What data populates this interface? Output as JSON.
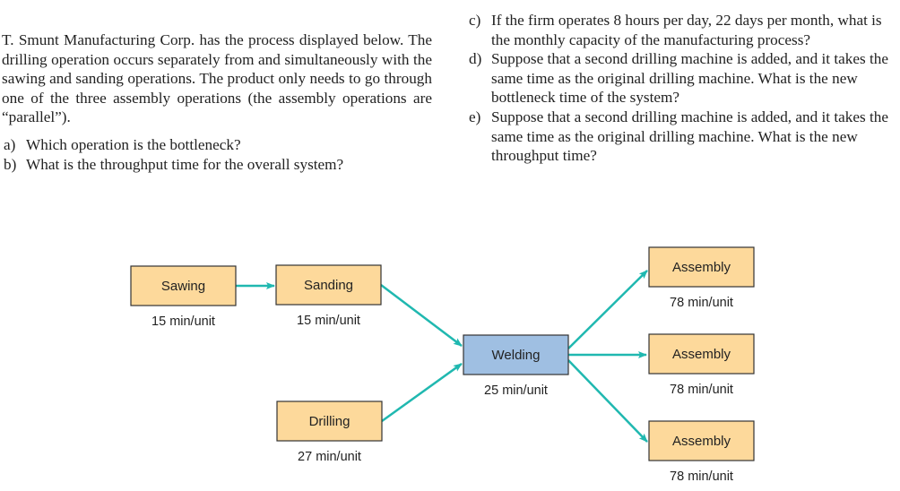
{
  "problem": {
    "intro": "T. Smunt Manufacturing Corp. has the process displayed below. The drilling operation occurs separately from and simultaneously with the sawing and sanding operations. The product only needs to go through one of the three assembly operations (the assembly operations are “parallel”).",
    "questions_left": [
      {
        "label": "a)",
        "text": "Which operation is the bottleneck?"
      },
      {
        "label": "b)",
        "text": "What is the throughput time for the overall system?"
      }
    ],
    "questions_right": [
      {
        "label": "c)",
        "text": "If the firm operates 8 hours per day, 22 days per month, what is the monthly capacity of the manufacturing process?"
      },
      {
        "label": "d)",
        "text": "Suppose that a second drilling machine is added, and it takes the same time as the original drilling machine. What is the new bottleneck time of the system?"
      },
      {
        "label": "e)",
        "text": "Suppose that a second drilling machine is added, and it takes the same time as the original drilling machine. What is the new throughput time?"
      }
    ]
  },
  "diagram": {
    "colors": {
      "operation_fill": "#fdd99b",
      "welding_fill": "#9fbfe2",
      "arrow": "#20b8b0",
      "border": "#333333"
    },
    "nodes": [
      {
        "id": "sawing",
        "label": "Sawing",
        "time": "15 min/unit"
      },
      {
        "id": "sanding",
        "label": "Sanding",
        "time": "15 min/unit"
      },
      {
        "id": "drilling",
        "label": "Drilling",
        "time": "27 min/unit"
      },
      {
        "id": "welding",
        "label": "Welding",
        "time": "25 min/unit"
      },
      {
        "id": "assembly1",
        "label": "Assembly",
        "time": "78 min/unit"
      },
      {
        "id": "assembly2",
        "label": "Assembly",
        "time": "78 min/unit"
      },
      {
        "id": "assembly3",
        "label": "Assembly",
        "time": "78 min/unit"
      }
    ],
    "edges": [
      {
        "from": "sawing",
        "to": "sanding"
      },
      {
        "from": "sanding",
        "to": "welding"
      },
      {
        "from": "drilling",
        "to": "welding"
      },
      {
        "from": "welding",
        "to": "assembly1"
      },
      {
        "from": "welding",
        "to": "assembly2"
      },
      {
        "from": "welding",
        "to": "assembly3"
      }
    ]
  }
}
